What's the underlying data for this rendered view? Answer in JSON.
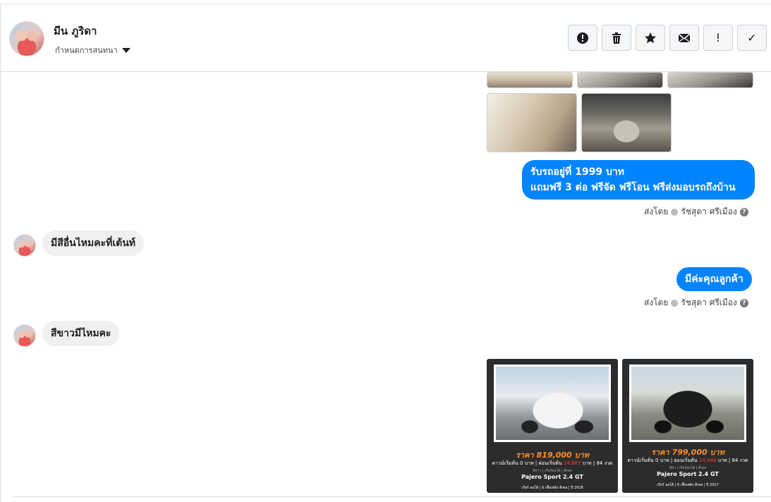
{
  "header": {
    "name": "มีน ภูริดา",
    "settings_label": "กำหนดการสนทนา",
    "toolbar": [
      {
        "name": "spam-button",
        "icon": "alert-circle-icon"
      },
      {
        "name": "delete-button",
        "icon": "trash-icon"
      },
      {
        "name": "star-button",
        "icon": "star-icon"
      },
      {
        "name": "mark-unread-button",
        "icon": "envelope-icon"
      },
      {
        "name": "follow-up-button",
        "icon": "exclamation-icon",
        "glyph": "!"
      },
      {
        "name": "mark-done-button",
        "icon": "check-icon",
        "glyph": "✓"
      }
    ]
  },
  "messages": {
    "m1_line1": "รับรถอยู่ที่  1999 บาท",
    "m1_line2": "แถมฟรี 3 ต่อ ฟรีจัด ฟรีโอน  ฟรีส่งมอบรถถึงบ้าน",
    "sent_by_1": "ส่งโดย",
    "sender_1": "รัชสุดา ศรีเมือง",
    "m2": "มีสีอื่นไหมคะที่เต้นท์",
    "m3": "มีค่ะคุณลูกค้า",
    "sent_by_2": "ส่งโดย",
    "sender_2": "รัชสุดา ศรีเมือง",
    "m4": "สีขาวมีไหมคะ"
  },
  "promos": [
    {
      "price": "ราคา 819,000 บาท",
      "terms_a": "ดาวน์เริ่มต้น 0 บาท | ผ่อนเริ่มต้น ",
      "terms_red": "14,887",
      "terms_b": " บาท | 84 งวด",
      "tiny": "สีขาว | เกียร์ออโต้ | ดีเซล",
      "model": "Pajero Sport 2.4 GT",
      "spec": "เกียร์ ออโต้  |  6 เชื้อเพลิง ดีเซล  |  ปี 2018"
    },
    {
      "price": "ราคา 799,000 บาท",
      "terms_a": "ดาวน์เริ่มต้น 0 บาท | ผ่อนเริ่มต้น ",
      "terms_red": "14,446",
      "terms_b": " บาท | 84 งวด",
      "tiny": "สีดำ | เกียร์ออโต้ | ดีเซล",
      "model": "Pajero Sport 2.4 GT",
      "spec": "เกียร์ ออโต้  |  6 เชื้อเพลิง ดีเซล  |  ปี 2017"
    }
  ]
}
